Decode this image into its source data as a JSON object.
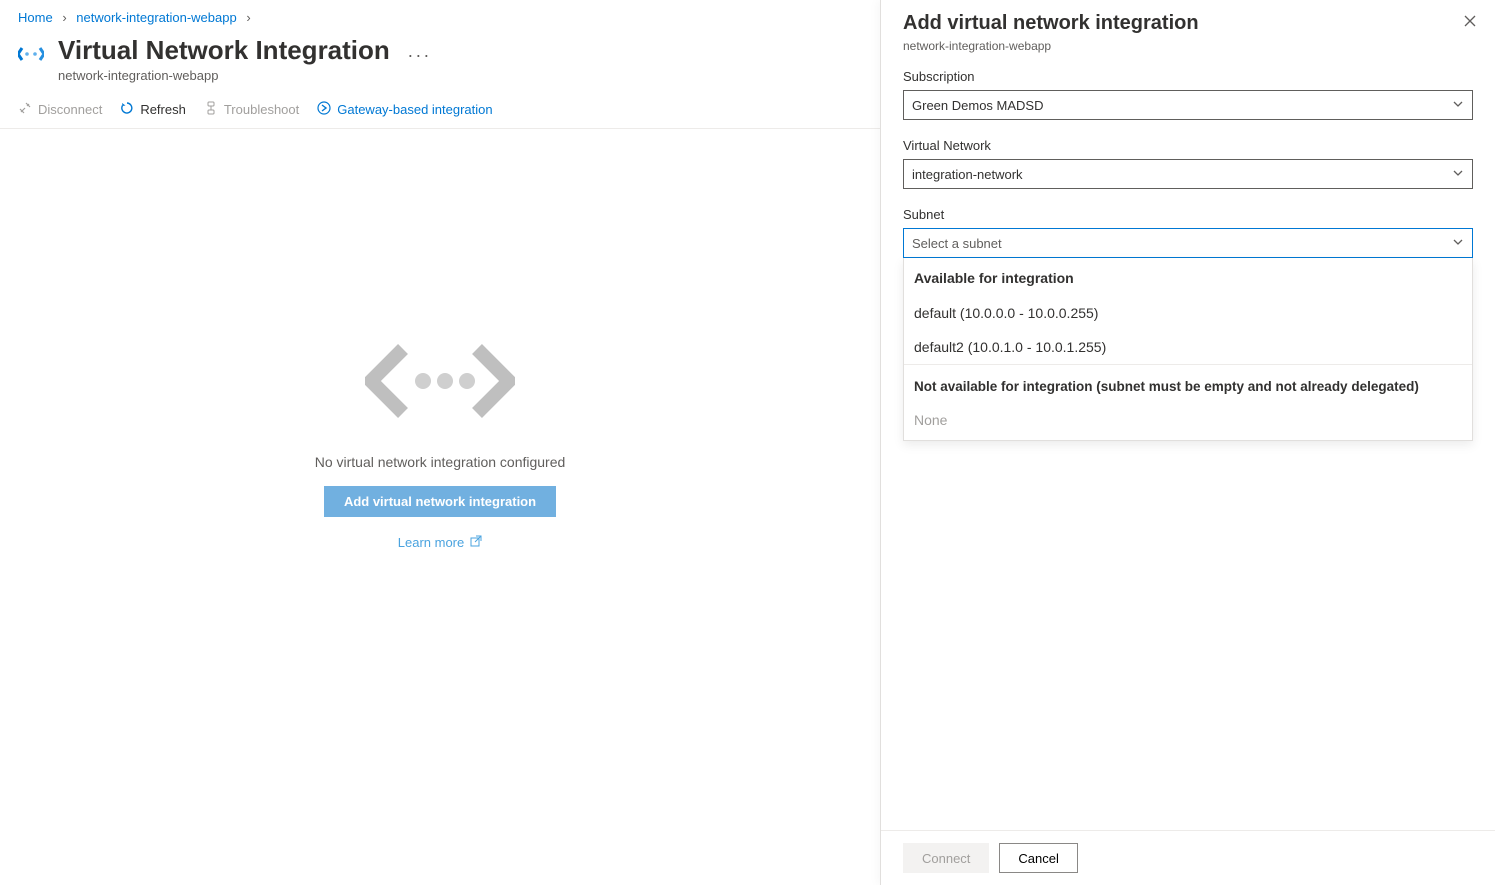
{
  "breadcrumb": {
    "home": "Home",
    "webapp": "network-integration-webapp"
  },
  "header": {
    "title": "Virtual Network Integration",
    "subtitle": "network-integration-webapp"
  },
  "toolbar": {
    "disconnect": "Disconnect",
    "refresh": "Refresh",
    "troubleshoot": "Troubleshoot",
    "gateway": "Gateway-based integration"
  },
  "empty": {
    "message": "No virtual network integration configured",
    "add_button": "Add virtual network integration",
    "learn_more": "Learn more"
  },
  "panel": {
    "title": "Add virtual network integration",
    "subtitle": "network-integration-webapp",
    "subscription_label": "Subscription",
    "subscription_value": "Green Demos MADSD",
    "vnet_label": "Virtual Network",
    "vnet_value": "integration-network",
    "subnet_label": "Subnet",
    "subnet_placeholder": "Select a subnet",
    "dropdown": {
      "available_header": "Available for integration",
      "option1": "default (10.0.0.0 - 10.0.0.255)",
      "option2": "default2 (10.0.1.0 - 10.0.1.255)",
      "na_header": "Not available for integration (subnet must be empty and not already delegated)",
      "na_item": "None"
    },
    "connect_button": "Connect",
    "cancel_button": "Cancel"
  }
}
